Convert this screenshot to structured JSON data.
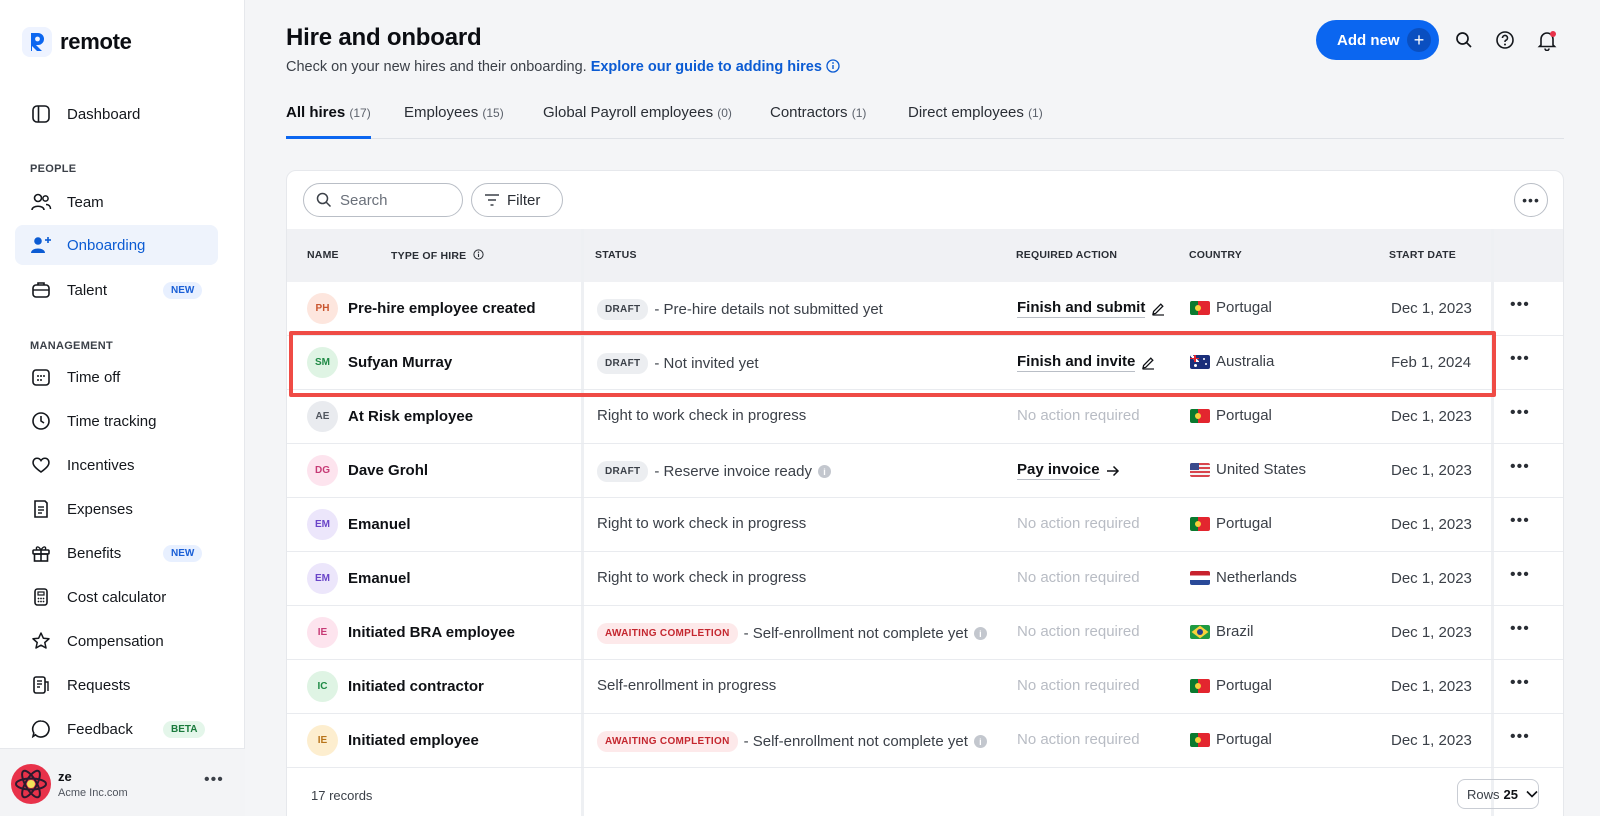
{
  "brand": {
    "name": "remote",
    "accent": "#0b66f0"
  },
  "sidebar": {
    "dashboard": "Dashboard",
    "people_section": "PEOPLE",
    "team": "Team",
    "onboarding": "Onboarding",
    "talent": "Talent",
    "talent_badge": "NEW",
    "management_section": "MANAGEMENT",
    "time_off": "Time off",
    "time_tracking": "Time tracking",
    "incentives": "Incentives",
    "expenses": "Expenses",
    "benefits": "Benefits",
    "benefits_badge": "NEW",
    "cost_calculator": "Cost calculator",
    "compensation": "Compensation",
    "requests": "Requests",
    "feedback": "Feedback",
    "feedback_badge": "BETA"
  },
  "user": {
    "name": "ze",
    "company": "Acme Inc.com"
  },
  "header": {
    "title": "Hire and onboard",
    "subtitle": "Check on your new hires and their onboarding.",
    "guide_link": "Explore our guide to adding hires",
    "add_button": "Add new"
  },
  "tabs": [
    {
      "label": "All hires",
      "count": "(17)"
    },
    {
      "label": "Employees",
      "count": "(15)"
    },
    {
      "label": "Global Payroll employees",
      "count": "(0)"
    },
    {
      "label": "Contractors",
      "count": "(1)"
    },
    {
      "label": "Direct employees",
      "count": "(1)"
    }
  ],
  "toolbar": {
    "search_placeholder": "Search",
    "filter_label": "Filter"
  },
  "columns": {
    "name": "NAME",
    "type": "TYPE OF HIRE",
    "status": "STATUS",
    "action": "REQUIRED ACTION",
    "country": "COUNTRY",
    "start": "START DATE"
  },
  "rows": [
    {
      "initials": "PH",
      "name": "Pre-hire employee created",
      "pill": "DRAFT",
      "status": "- Pre-hire details not submitted yet",
      "action": "Finish and submit",
      "country": "Portugal",
      "start": "Dec 1, 2023"
    },
    {
      "initials": "SM",
      "name": "Sufyan Murray",
      "pill": "DRAFT",
      "status": "- Not invited yet",
      "action": "Finish and invite",
      "country": "Australia",
      "start": "Feb 1, 2024"
    },
    {
      "initials": "AE",
      "name": "At Risk employee",
      "pill": "",
      "status": "Right to work check in progress",
      "action": "No action required",
      "country": "Portugal",
      "start": "Dec 1, 2023"
    },
    {
      "initials": "DG",
      "name": "Dave Grohl",
      "pill": "DRAFT",
      "status": "- Reserve invoice ready",
      "action": "Pay invoice",
      "country": "United States",
      "start": "Dec 1, 2023"
    },
    {
      "initials": "EM",
      "name": "Emanuel",
      "pill": "",
      "status": "Right to work check in progress",
      "action": "No action required",
      "country": "Portugal",
      "start": "Dec 1, 2023"
    },
    {
      "initials": "EM",
      "name": "Emanuel",
      "pill": "",
      "status": "Right to work check in progress",
      "action": "No action required",
      "country": "Netherlands",
      "start": "Dec 1, 2023"
    },
    {
      "initials": "IE",
      "name": "Initiated BRA employee",
      "pill": "AWAITING COMPLETION",
      "status": "- Self-enrollment not complete yet",
      "action": "No action required",
      "country": "Brazil",
      "start": "Dec 1, 2023"
    },
    {
      "initials": "IC",
      "name": "Initiated contractor",
      "pill": "",
      "status": "Self-enrollment in progress",
      "action": "No action required",
      "country": "Portugal",
      "start": "Dec 1, 2023"
    },
    {
      "initials": "IE",
      "name": "Initiated employee",
      "pill": "AWAITING COMPLETION",
      "status": "- Self-enrollment not complete yet",
      "action": "No action required",
      "country": "Portugal",
      "start": "Dec 1, 2023"
    }
  ],
  "footer": {
    "records": "17 records",
    "rows_label": "Rows",
    "rows_value": "25"
  }
}
